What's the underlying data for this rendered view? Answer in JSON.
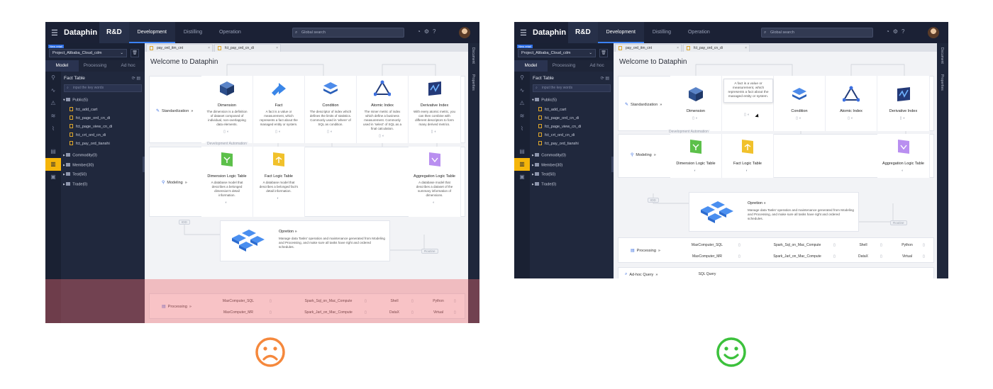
{
  "colors": {
    "sad_face": "#f5883c",
    "happy_face": "#3cc13c",
    "overlay": "#ee6870",
    "topbar": "#1b2135",
    "sidebar": "#20283d",
    "accent": "#3b82f6",
    "highlight": "#f5b50a"
  },
  "app": {
    "logo": "Dataphin",
    "env": "R&D",
    "nav": [
      "Development",
      "Distilling",
      "Operation"
    ],
    "search_placeholder": "Global search",
    "project_badge": "New retail",
    "project": "Project_Alibaba_Cloud_cdm",
    "side_tabs": [
      "Model",
      "Processing",
      "Ad hoc"
    ],
    "tree_title": "Fact Table",
    "tree_search": "input the key words",
    "tree_public": "Public(5)",
    "tree_files": [
      "fct_add_cart",
      "fct_page_ord_cn_di",
      "fct_page_view_cn_di",
      "fct_crt_ord_cn_di",
      "fct_pay_ord_tianshi"
    ],
    "tree_groups": [
      "Commodity(0)",
      "Member(30)",
      "Test(50)",
      "Trade(0)"
    ],
    "file_tabs": [
      "pay_ord_itm_cnt",
      "fct_pay_ord_cn_di"
    ],
    "right_panel": [
      "Document",
      "Properties"
    ],
    "welcome": "Welcome to Dataphin",
    "standardization": "Standardization",
    "modeling": "Modeling",
    "processing": "Processing",
    "adhoc": "Ad-hoc Query",
    "dev_automation": "Development Automation",
    "std_cards": [
      {
        "title": "Dimension",
        "desc": "The dimension is a definition of dataset composed of individual, non-overlapping data elements."
      },
      {
        "title": "Fact",
        "desc": "A fact is a value or measurement, which represents a fact about the managed entity or system."
      },
      {
        "title": "Condition",
        "desc": "The descriptor of index which defines the limits of statistics. Commonly used in 'where' of SQL as condition."
      },
      {
        "title": "Atomic Index",
        "desc": "The miner metric of index which define a business measurement. Commonly used in 'select' of SQL as a final calculation."
      },
      {
        "title": "Derivative Index",
        "desc": "With every atomic metric, you can then combine with different descriptors to form many derived metrics."
      }
    ],
    "model_cards": [
      {
        "title": "Dimension Logic Table",
        "desc": "A database model that describes a belonged dimension's detail information."
      },
      {
        "title": "Fact Logic Table",
        "desc": "A database model that describes a belonged fact's detail information."
      },
      {
        "title": "Aggregation Logic Table",
        "desc": "A database model that describes a dataset of the summary information of dimensions."
      }
    ],
    "operation_title": "Opretion",
    "operation_desc": "Manage data Tasks' operation and maintenance generated from Modeling and Processing, and make sure all tasks have right and ordered schedules.",
    "pill_idd": "IDD",
    "pill_routine": "Routine",
    "processing_rows": [
      [
        "MaxComputer_SQL",
        "Spark_Sql_on_Mac_Compute",
        "Shell",
        "Python"
      ],
      [
        "MaxComputer_MR",
        "Spark_Jarl_on_Mac_Compute",
        "DataX",
        "Virtual"
      ]
    ],
    "adhoc_item": "SQL Query"
  }
}
